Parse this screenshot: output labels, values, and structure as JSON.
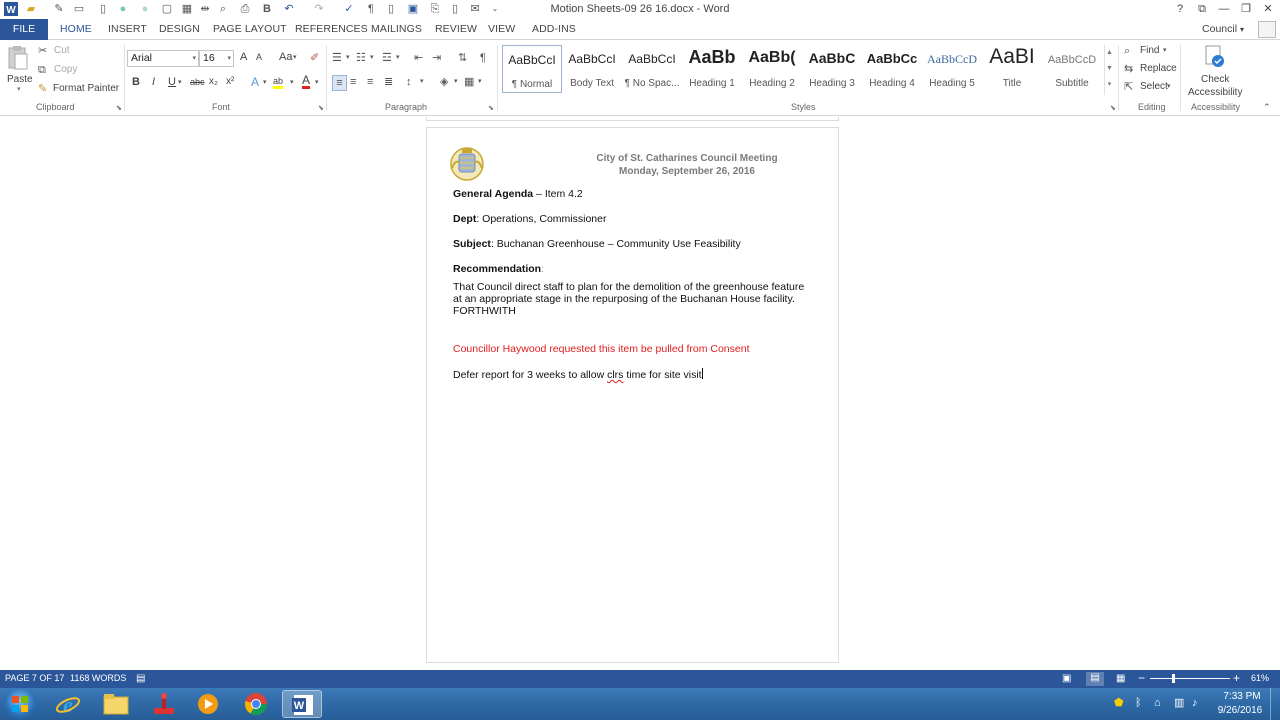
{
  "window": {
    "title": "Motion Sheets-09 26 16.docx - Word",
    "user": "Council",
    "user_caret": "▾",
    "help": "?",
    "ribbon_display": "⧉",
    "minimize": "—",
    "restore": "❐",
    "close": "✕"
  },
  "tabs": [
    "FILE",
    "HOME",
    "INSERT",
    "DESIGN",
    "PAGE LAYOUT",
    "REFERENCES",
    "MAILINGS",
    "REVIEW",
    "VIEW",
    "ADD-INS"
  ],
  "ribbon": {
    "clipboard": {
      "paste": "Paste",
      "cut": "Cut",
      "copy": "Copy",
      "format_painter": "Format Painter",
      "label": "Clipboard"
    },
    "font": {
      "name": "Arial",
      "size": "16",
      "grow": "A",
      "shrink": "A",
      "change_case": "Aa",
      "bold": "B",
      "italic": "I",
      "underline": "U",
      "strike": "abc",
      "subscript": "x₂",
      "superscript": "x²",
      "text_effects": "A",
      "highlight": "ab",
      "font_color": "A",
      "label": "Font"
    },
    "paragraph": {
      "label": "Paragraph",
      "pilcrow": "¶"
    },
    "styles": {
      "label": "Styles",
      "items": [
        {
          "preview": "AaBbCcI",
          "label": "¶ Normal"
        },
        {
          "preview": "AaBbCcI",
          "label": "Body Text"
        },
        {
          "preview": "AaBbCcI",
          "label": "¶ No Spac..."
        },
        {
          "preview": "AaBb",
          "label": "Heading 1"
        },
        {
          "preview": "AaBb(",
          "label": "Heading 2"
        },
        {
          "preview": "AaBbC",
          "label": "Heading 3"
        },
        {
          "preview": "AaBbCc",
          "label": "Heading 4"
        },
        {
          "preview": "AaBbCcD",
          "label": "Heading 5"
        },
        {
          "preview": "AaBI",
          "label": "Title"
        },
        {
          "preview": "AaBbCcD",
          "label": "Subtitle"
        }
      ]
    },
    "editing": {
      "find": "Find",
      "replace": "Replace",
      "select": "Select",
      "label": "Editing"
    },
    "accessibility": {
      "check_line1": "Check",
      "check_line2": "Accessibility",
      "label": "Accessibility"
    }
  },
  "document": {
    "header_line1": "City of St. Catharines Council Meeting",
    "header_line2": "Monday, September 26, 2016",
    "agenda_label": "General Agenda",
    "agenda_value": " – Item 4.2",
    "dept_label": "Dept",
    "dept_value": ": Operations, Commissioner",
    "subject_label": "Subject",
    "subject_value": ": Buchanan Greenhouse – Community Use Feasibility",
    "recommendation_label": "Recommendation",
    "recommendation_colon": ":",
    "recommendation_line1": "That Council direct staff to plan for the demolition of the greenhouse feature",
    "recommendation_line2": "at an appropriate stage in the repurposing of the Buchanan House facility.",
    "recommendation_line3": "FORTHWITH",
    "note_red": "Councillor Haywood requested this item be pulled from Consent",
    "defer_before": "Defer report for 3 weeks to allow ",
    "defer_misspelled": "clrs",
    "defer_after": " time for site visit"
  },
  "status": {
    "page": "PAGE 7 OF 17",
    "words": "1168 WORDS",
    "zoom": "61%",
    "zoom_level_percent": 61
  },
  "taskbar": {
    "time": "7:33 PM",
    "date": "9/26/2016"
  },
  "colors": {
    "word_blue": "#2b579a",
    "red_text": "#e02020"
  }
}
